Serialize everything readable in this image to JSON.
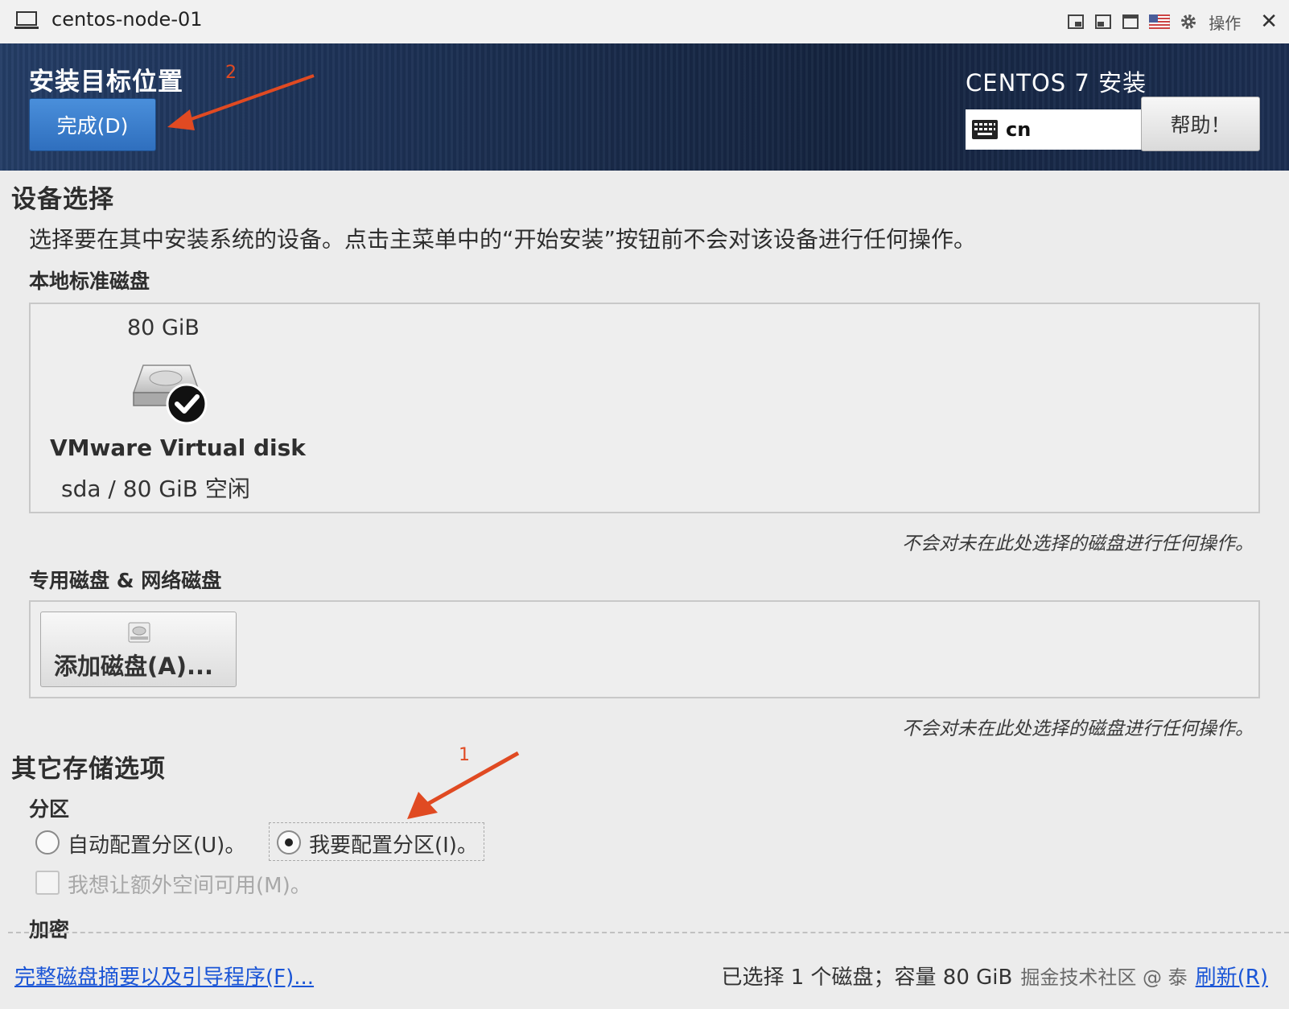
{
  "window": {
    "title": "centos-node-01",
    "actions_label": "操作",
    "icons": [
      "computer-icon",
      "restore-window-icon",
      "window-mode-icon",
      "fullscreen-icon",
      "us-flag-icon",
      "gear-icon",
      "close-icon"
    ]
  },
  "header": {
    "page_title": "安装目标位置",
    "done_button": "完成(D)",
    "product_title": "CENTOS 7 安装",
    "keyboard_layout": "cn",
    "help_button": "帮助！",
    "colors": {
      "header_bg": "#1b2f52",
      "done_bg": "#3b7dcc"
    }
  },
  "annotations": {
    "arrow_1_number": "1",
    "arrow_2_number": "2",
    "arrow_color": "#e04a22"
  },
  "device_selection": {
    "heading": "设备选择",
    "description": "选择要在其中安装系统的设备。点击主菜单中的“开始安装”按钮前不会对该设备进行任何操作。",
    "local_disks_heading": "本地标准磁盘",
    "disk": {
      "capacity": "80 GiB",
      "name": "VMware Virtual disk",
      "info": "sda   /   80 GiB 空闲",
      "selected": true
    },
    "local_note": "不会对未在此处选择的磁盘进行任何操作。",
    "special_disks_heading": "专用磁盘 & 网络磁盘",
    "add_disk_button": "添加磁盘(A)...",
    "special_note": "不会对未在此处选择的磁盘进行任何操作。"
  },
  "other_options": {
    "heading": "其它存储选项",
    "partition_heading": "分区",
    "auto_partition": "自动配置分区(U)。",
    "manual_partition": "我要配置分区(I)。",
    "selected_partition": "manual",
    "extra_space": "我想让额外空间可用(M)。",
    "extra_space_checked": false,
    "encryption_heading": "加密"
  },
  "footer": {
    "summary_link": "完整磁盘摘要以及引导程序(F)...",
    "status": "已选择 1 个磁盘；容量 80 GiB",
    "watermark": "掘金技术社区 @ 泰",
    "refresh_link": "刷新(R)"
  }
}
